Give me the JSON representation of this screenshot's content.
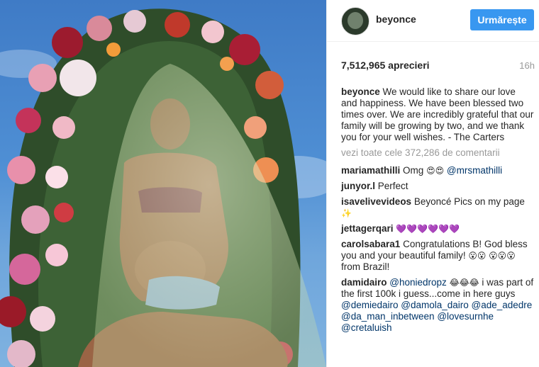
{
  "post": {
    "username": "beyonce",
    "follow_label": "Urmărește",
    "likes_text": "7,512,965 aprecieri",
    "time_ago": "16h",
    "caption_user": "beyonce",
    "caption_text": "We would like to share our love and happiness. We have been blessed two times over. We are incredibly grateful that our family will be growing by two, and we thank you for your well wishes. - The Carters",
    "view_all_comments": "vezi toate cele 372,286 de comentarii"
  },
  "comments": [
    {
      "user": "mariamathilli",
      "text": "Omg",
      "emoji": "😍😍",
      "mention": "@mrsmathilli"
    },
    {
      "user": "junyor.l",
      "text": "Perfect"
    },
    {
      "user": "isavelivevideos",
      "text": "Beyoncé Pics on my page",
      "emoji": "✨"
    },
    {
      "user": "jettagerqari",
      "emoji": "💜💜💜💜💜💜"
    },
    {
      "user": "carolsabara1",
      "text": "Congratulations B! God bless you and your beautiful family!",
      "emoji": "😮😮",
      "emoji2": "😮😮😮",
      "text2": "from Brazil!"
    },
    {
      "user": "damidairo",
      "mention": "@honiedropz",
      "emoji": "😂😂😂",
      "text": "i was part of the first 100k i guess...come in here guys",
      "mentions2": "@demiedairo @damola_dairo @ade_adedre @da_man_inbetween",
      "tail": "@lovesurnhe @cretaluish"
    }
  ],
  "colors": {
    "follow_bg": "#3897f0",
    "mention": "#003569",
    "muted": "#999999"
  }
}
